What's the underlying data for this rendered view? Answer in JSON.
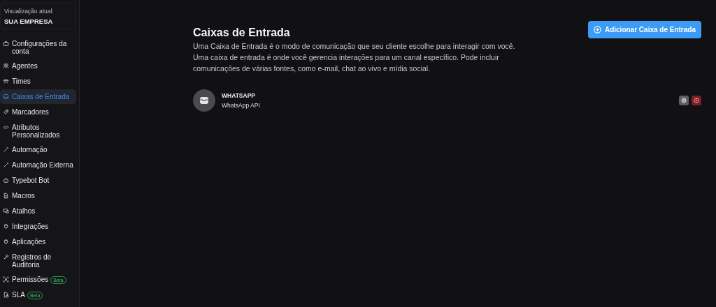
{
  "account": {
    "label": "Visualização atual:",
    "name": "SUA EMPRESA"
  },
  "sidebar": {
    "items": [
      {
        "label": "Configurações da conta",
        "selected": false
      },
      {
        "label": "Agentes",
        "selected": false
      },
      {
        "label": "Times",
        "selected": false
      },
      {
        "label": "Caixas de Entrada",
        "selected": true
      },
      {
        "label": "Marcadores",
        "selected": false
      },
      {
        "label": "Atributos Personalizados",
        "selected": false
      },
      {
        "label": "Automação",
        "selected": false
      },
      {
        "label": "Automação Externa",
        "selected": false
      },
      {
        "label": "Typebot Bot",
        "selected": false
      },
      {
        "label": "Macros",
        "selected": false
      },
      {
        "label": "Atalhos",
        "selected": false
      },
      {
        "label": "Integrações",
        "selected": false
      },
      {
        "label": "Aplicações",
        "selected": false
      },
      {
        "label": "Registros de Auditoria",
        "selected": false
      },
      {
        "label": "Permissões",
        "selected": false,
        "badge": "Beta"
      },
      {
        "label": "SLA",
        "selected": false,
        "badge": "Beta"
      }
    ]
  },
  "header": {
    "title": "Caixas de Entrada",
    "description": "Uma Caixa de Entrada é o modo de comunicação que seu cliente escolhe para interagir com você. Uma caixa de entrada é onde você gerencia interações para um canal específico. Pode incluir comunicações de várias fontes, como e-mail, chat ao vivo e mídia social.",
    "add_button": "Adicionar Caixa de Entrada"
  },
  "inboxes": [
    {
      "name": "WHATSAPP",
      "channel": "WhatsApp API"
    }
  ]
}
